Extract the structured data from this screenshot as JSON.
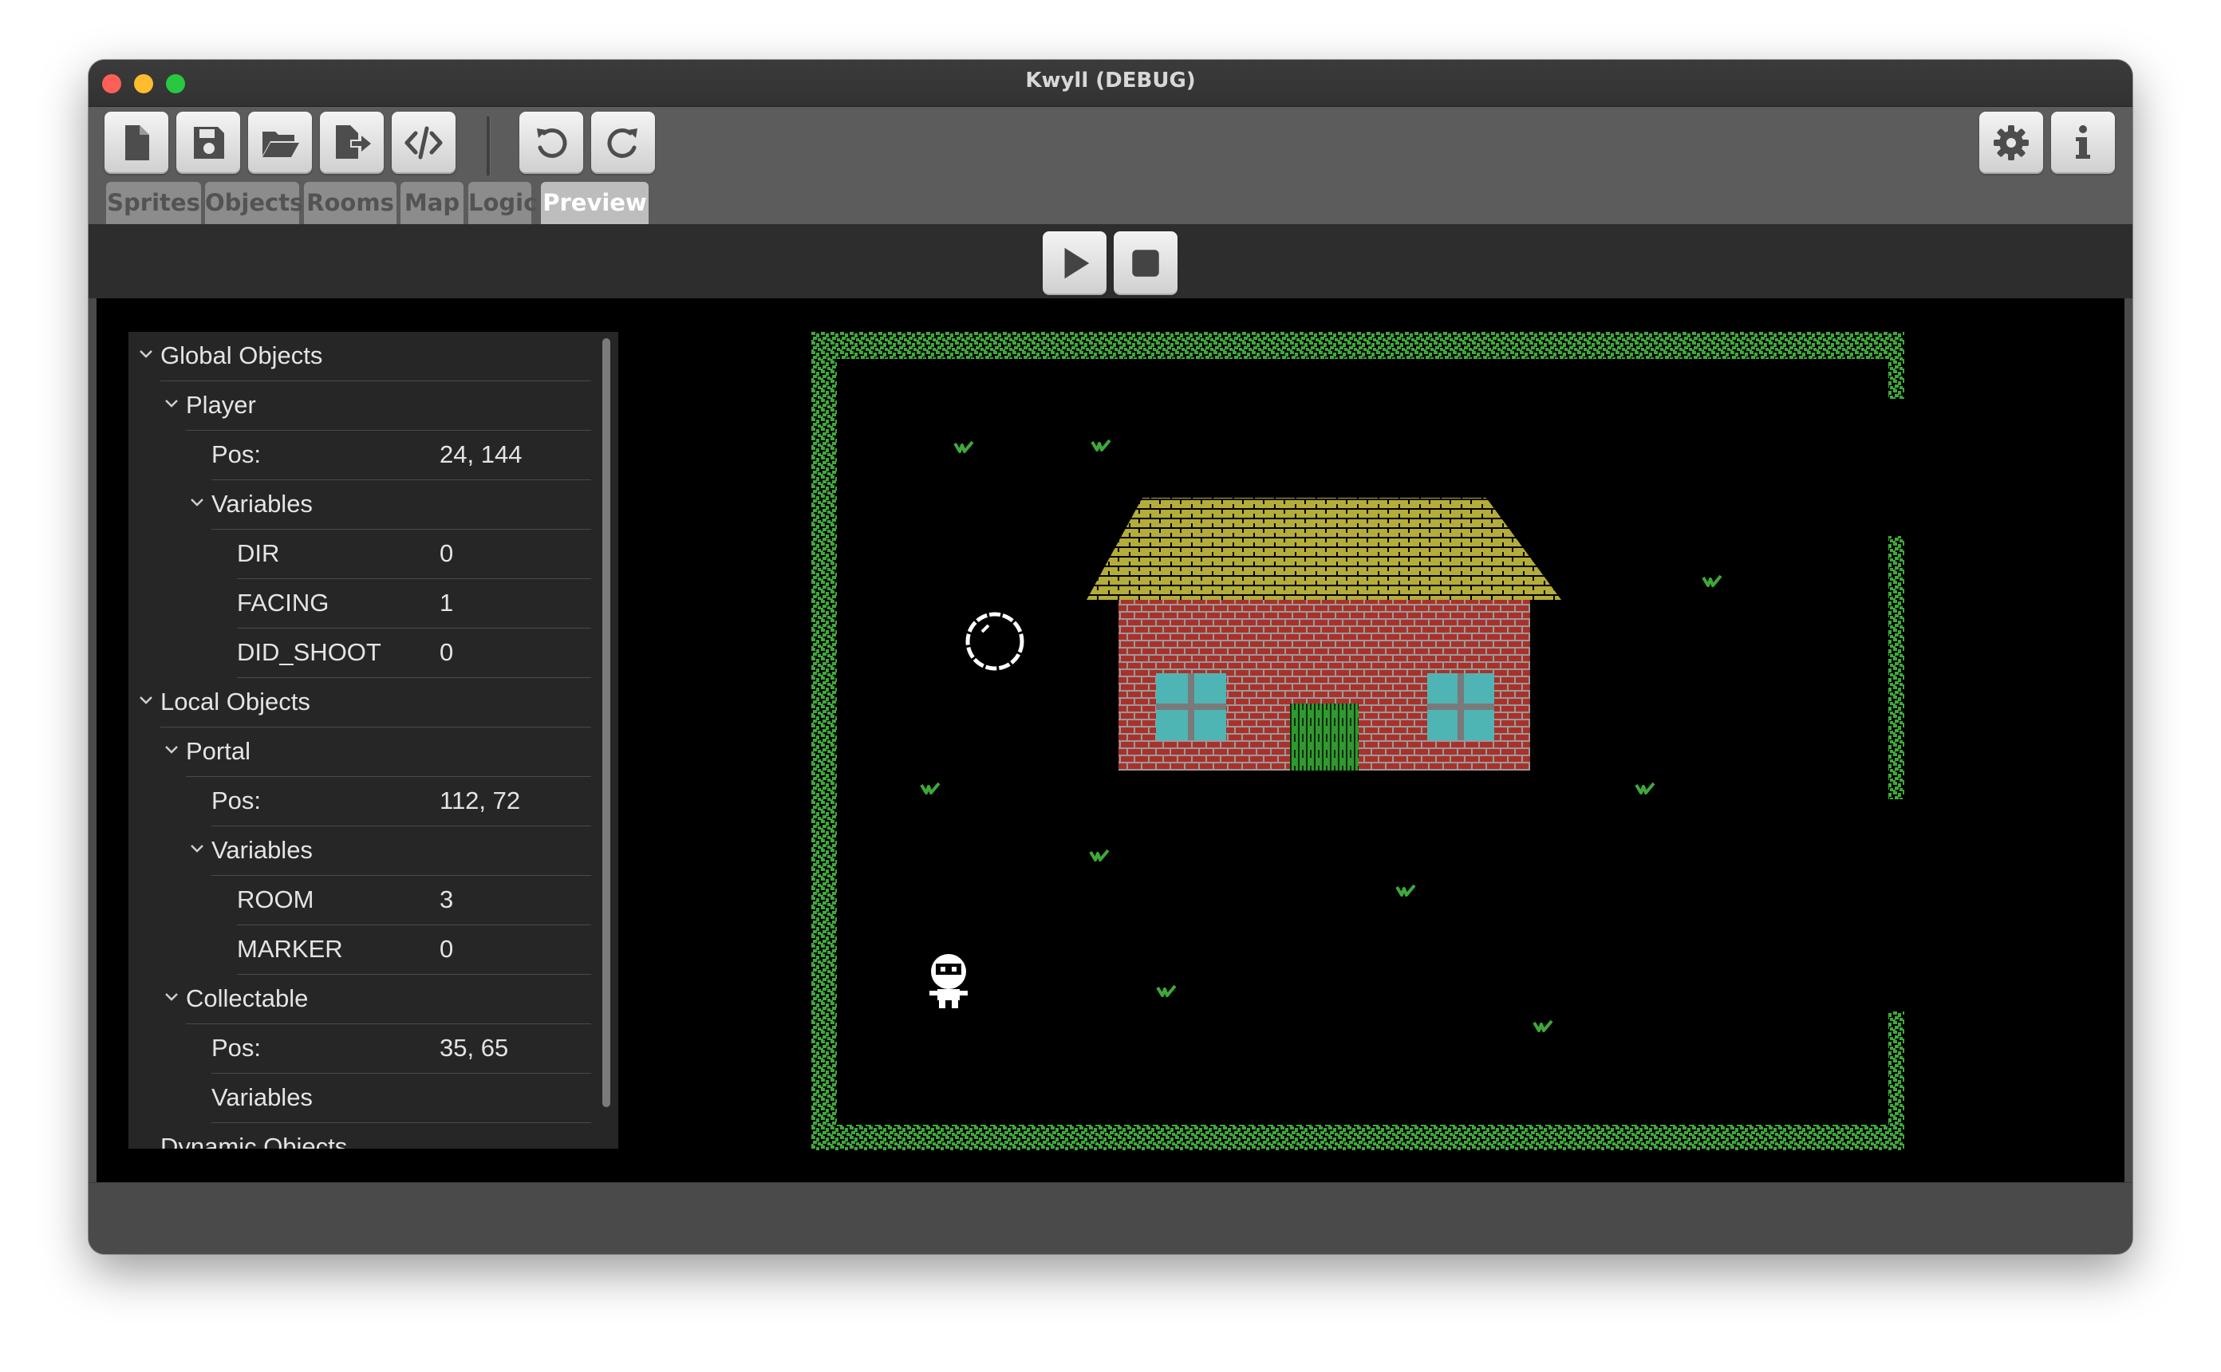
{
  "window": {
    "title": "Kwyll (DEBUG)"
  },
  "toolbar": {
    "buttons": [
      {
        "name": "new-file-icon",
        "action": "New"
      },
      {
        "name": "save-icon",
        "action": "Save"
      },
      {
        "name": "open-folder-icon",
        "action": "Open"
      },
      {
        "name": "export-icon",
        "action": "Export"
      },
      {
        "name": "code-icon",
        "action": "Code"
      },
      {
        "name": "undo-icon",
        "action": "Undo"
      },
      {
        "name": "redo-icon",
        "action": "Redo"
      },
      {
        "name": "gear-icon",
        "action": "Settings"
      },
      {
        "name": "info-icon",
        "action": "About"
      }
    ]
  },
  "tabs": [
    "Sprites",
    "Objects",
    "Rooms",
    "Map",
    "Logic",
    "Preview"
  ],
  "active_tab": "Preview",
  "run_controls": {
    "play": "play-icon",
    "stop": "stop-icon"
  },
  "inspector": {
    "global_objects": "Global Objects",
    "player": {
      "name": "Player",
      "pos_label": "Pos:",
      "pos": "24, 144",
      "variables_label": "Variables",
      "vars": [
        {
          "name": "DIR",
          "value": "0"
        },
        {
          "name": "FACING",
          "value": "1"
        },
        {
          "name": "DID_SHOOT",
          "value": "0"
        }
      ]
    },
    "local_objects": "Local Objects",
    "portal": {
      "name": "Portal",
      "pos_label": "Pos:",
      "pos": "112, 72",
      "variables_label": "Variables",
      "vars": [
        {
          "name": "ROOM",
          "value": "3"
        },
        {
          "name": "MARKER",
          "value": "0"
        }
      ]
    },
    "collectable": {
      "name": "Collectable",
      "pos_label": "Pos:",
      "pos": "35, 65",
      "variables_label": "Variables"
    },
    "dynamic_objects": "Dynamic Objects"
  },
  "colors": {
    "window_bg": "#4a4a4a",
    "toolbar_bg": "#5c5c5c",
    "tab_inactive": "#8c8c8c",
    "tab_active": "#bdbdbd",
    "wall_green": "#3fa83a",
    "grass_green": "#3fa83a",
    "roof_yellow": "#b4ad3a",
    "brick_red": "#a8322b",
    "mortar_gray": "#9a9a9a",
    "window_cyan": "#4fb4b4",
    "door_green": "#2f9a2f"
  }
}
